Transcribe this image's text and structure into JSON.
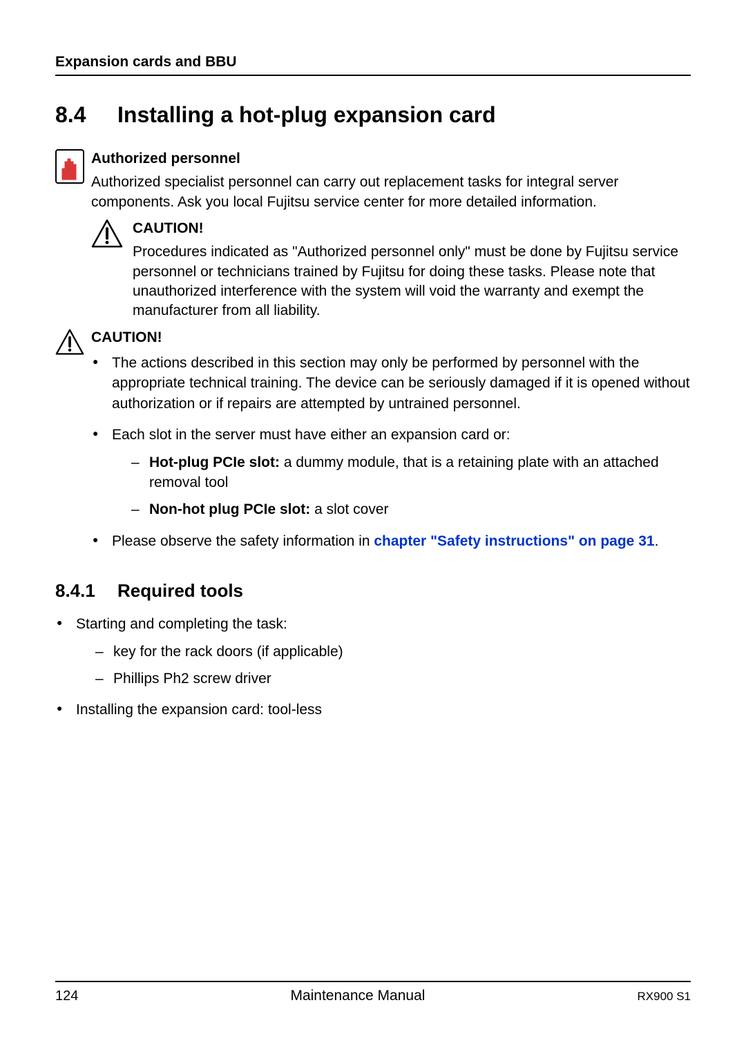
{
  "header": {
    "section": "Expansion cards and BBU"
  },
  "heading": {
    "number": "8.4",
    "title": "Installing a hot-plug expansion card"
  },
  "auth_notice": {
    "title": "Authorized personnel",
    "body": "Authorized specialist personnel can carry out replacement tasks for integral server components. Ask you local Fujitsu service center for more detailed information."
  },
  "nested_caution": {
    "title": "CAUTION!",
    "body": "Procedures indicated as \"Authorized personnel only\" must be done by Fujitsu service personnel or technicians trained by Fujitsu for doing these tasks. Please note that unauthorized interference with the system will void the warranty and exempt the manufacturer from all liability."
  },
  "caution2": {
    "title": "CAUTION!",
    "bullets": {
      "b1": "The actions described in this section may only be performed by personnel with the appropriate technical training. The device can be seriously damaged if it is opened without authorization or if repairs are attempted by untrained personnel.",
      "b2_intro": "Each slot in the server must have either an expansion card or:",
      "b2_d1_bold": "Hot-plug PCIe slot:",
      "b2_d1_rest": " a dummy module, that is a retaining plate with an attached removal tool",
      "b2_d2_bold": "Non-hot plug PCIe slot:",
      "b2_d2_rest": " a slot cover",
      "b3_pre": "Please observe the safety information in ",
      "b3_link": "chapter \"Safety instructions\" on page 31",
      "b3_post": "."
    }
  },
  "subheading": {
    "number": "8.4.1",
    "title": "Required tools"
  },
  "tools": {
    "b1_intro": "Starting and completing the task:",
    "b1_d1": "key for the rack doors (if applicable)",
    "b1_d2": "Phillips Ph2 screw driver",
    "b2": "Installing the expansion card: tool-less"
  },
  "footer": {
    "page": "124",
    "center": "Maintenance Manual",
    "right": "RX900 S1"
  }
}
